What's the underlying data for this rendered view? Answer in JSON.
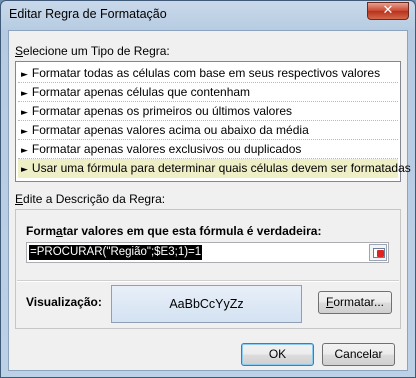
{
  "window": {
    "title": "Editar Regra de Formatação",
    "close_symbol": "✕"
  },
  "rule_type": {
    "label_accesskey": "S",
    "label_rest": "elecione um Tipo de Regra:",
    "items": [
      {
        "label": "Formatar todas as células com base em seus respectivos valores"
      },
      {
        "label": "Formatar apenas células que contenham"
      },
      {
        "label": "Formatar apenas os primeiros ou últimos valores"
      },
      {
        "label": "Formatar apenas valores acima ou abaixo da média"
      },
      {
        "label": "Formatar apenas valores exclusivos ou duplicados"
      },
      {
        "label": "Usar uma fórmula para determinar quais células devem ser formatadas",
        "selected": true
      }
    ],
    "arrow_symbol": "►"
  },
  "rule_description": {
    "label_accesskey": "E",
    "label_rest": "dite a Descrição da Regra:",
    "formula_label_pre": "Form",
    "formula_label_accesskey": "a",
    "formula_label_post": "tar valores em que esta fórmula é verdadeira:",
    "formula_value": "=PROCURAR(\"Região\";$E3;1)=1",
    "preview_label": "Visualização:",
    "preview_sample": "AaBbCcYyZz",
    "format_button_accesskey": "F",
    "format_button_rest": "ormatar..."
  },
  "footer": {
    "ok_label": "OK",
    "cancel_label": "Cancelar"
  }
}
